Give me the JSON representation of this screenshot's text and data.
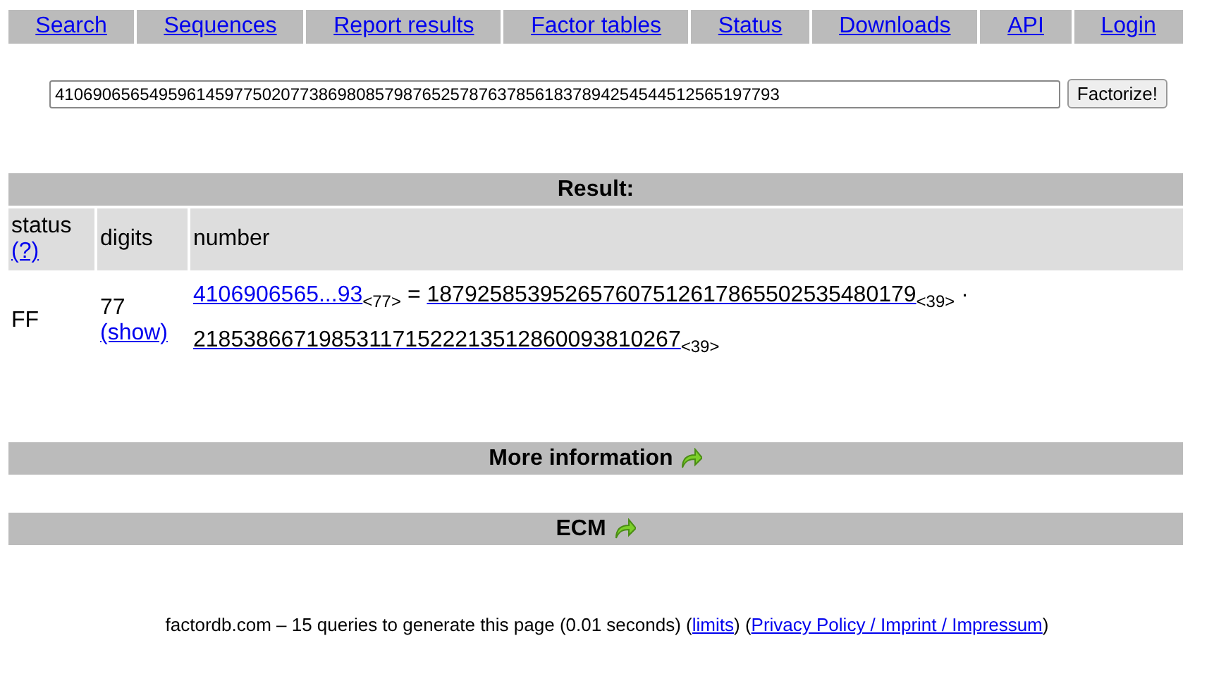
{
  "nav": [
    {
      "label": "Search"
    },
    {
      "label": "Sequences"
    },
    {
      "label": "Report results"
    },
    {
      "label": "Factor tables"
    },
    {
      "label": "Status"
    },
    {
      "label": "Downloads"
    },
    {
      "label": "API"
    },
    {
      "label": "Login"
    }
  ],
  "query": {
    "value": "41069065654959614597750207738698085798765257876378561837894254544512565197793",
    "button": "Factorize!"
  },
  "result": {
    "title": "Result:",
    "columns": [
      {
        "label": "status",
        "help": "(?)"
      },
      {
        "label": "digits"
      },
      {
        "label": "number"
      }
    ],
    "row": {
      "status": "FF",
      "digits": "77",
      "show": "(show)",
      "number": "4106906565...93",
      "size": "<77>",
      "equals": "=",
      "separator": "·",
      "factors": [
        {
          "value": "187925853952657607512617865502535480179",
          "size": "<39>"
        },
        {
          "value": "218538667198531171522213512860093810267",
          "size": "<39>"
        }
      ]
    }
  },
  "sections": [
    {
      "title": "More information"
    },
    {
      "title": "ECM"
    }
  ],
  "footer": [
    {
      "kind": "text",
      "text": "factordb.com – 15 queries to generate this page (0.01 seconds) ("
    },
    {
      "kind": "link",
      "text": "limits"
    },
    {
      "kind": "text",
      "text": ") ("
    },
    {
      "kind": "link",
      "text": "Privacy Policy / Imprint / Impressum"
    },
    {
      "kind": "text",
      "text": ")"
    }
  ]
}
